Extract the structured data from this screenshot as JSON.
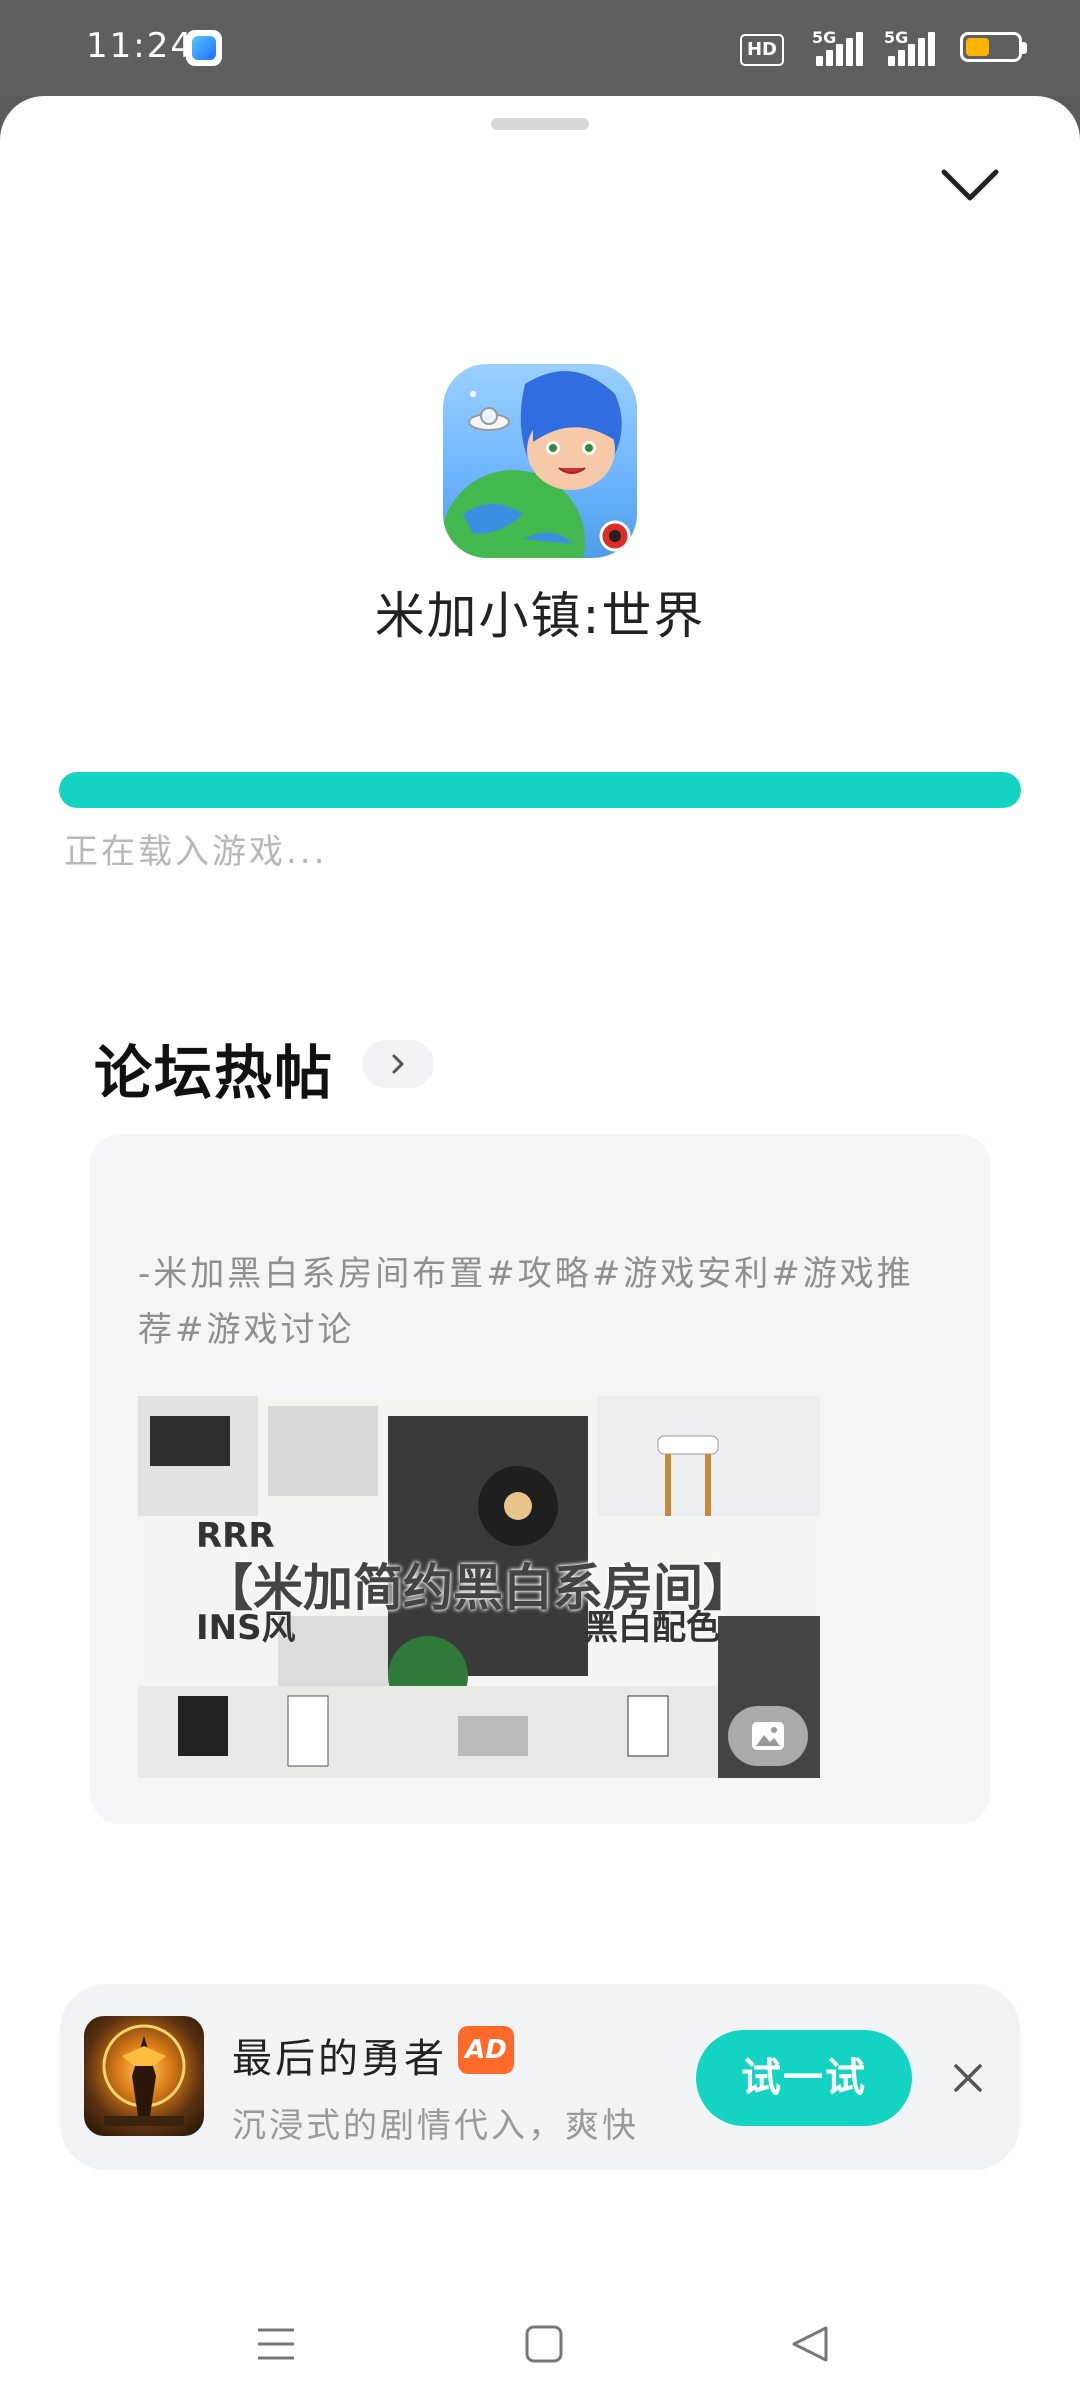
{
  "status_bar": {
    "time": "11:24",
    "hd_label": "HD",
    "signal_1_label": "5G",
    "signal_2_label": "5G",
    "battery_level": 0.45,
    "battery_color": "#ffb400"
  },
  "loading": {
    "game_title": "米加小镇:世界",
    "progress": 1.0,
    "progress_color": "#13d4c3",
    "status_text": "正在载入游戏..."
  },
  "forum": {
    "section_title": "论坛热帖",
    "post": {
      "text": "-米加黑白系房间布置#攻略#游戏安利#游戏推荐#游戏讨论",
      "image_title": "【米加简约黑白系房间】",
      "image_sub_1": "RRR",
      "image_sub_2": "INS风",
      "image_sub_3": "黑白配色"
    }
  },
  "ad": {
    "title": "最后的勇者",
    "tag": "AD",
    "description": "沉浸式的剧情代入，爽快",
    "cta_label": "试一试",
    "accent_color": "#13d4c3"
  },
  "icons": {
    "collapse": "chevron-down-icon",
    "more": "chevron-right-icon",
    "image_badge": "image-icon",
    "close": "close-icon",
    "nav_menu": "menu-icon",
    "nav_home": "square-home-icon",
    "nav_back": "triangle-back-icon"
  }
}
